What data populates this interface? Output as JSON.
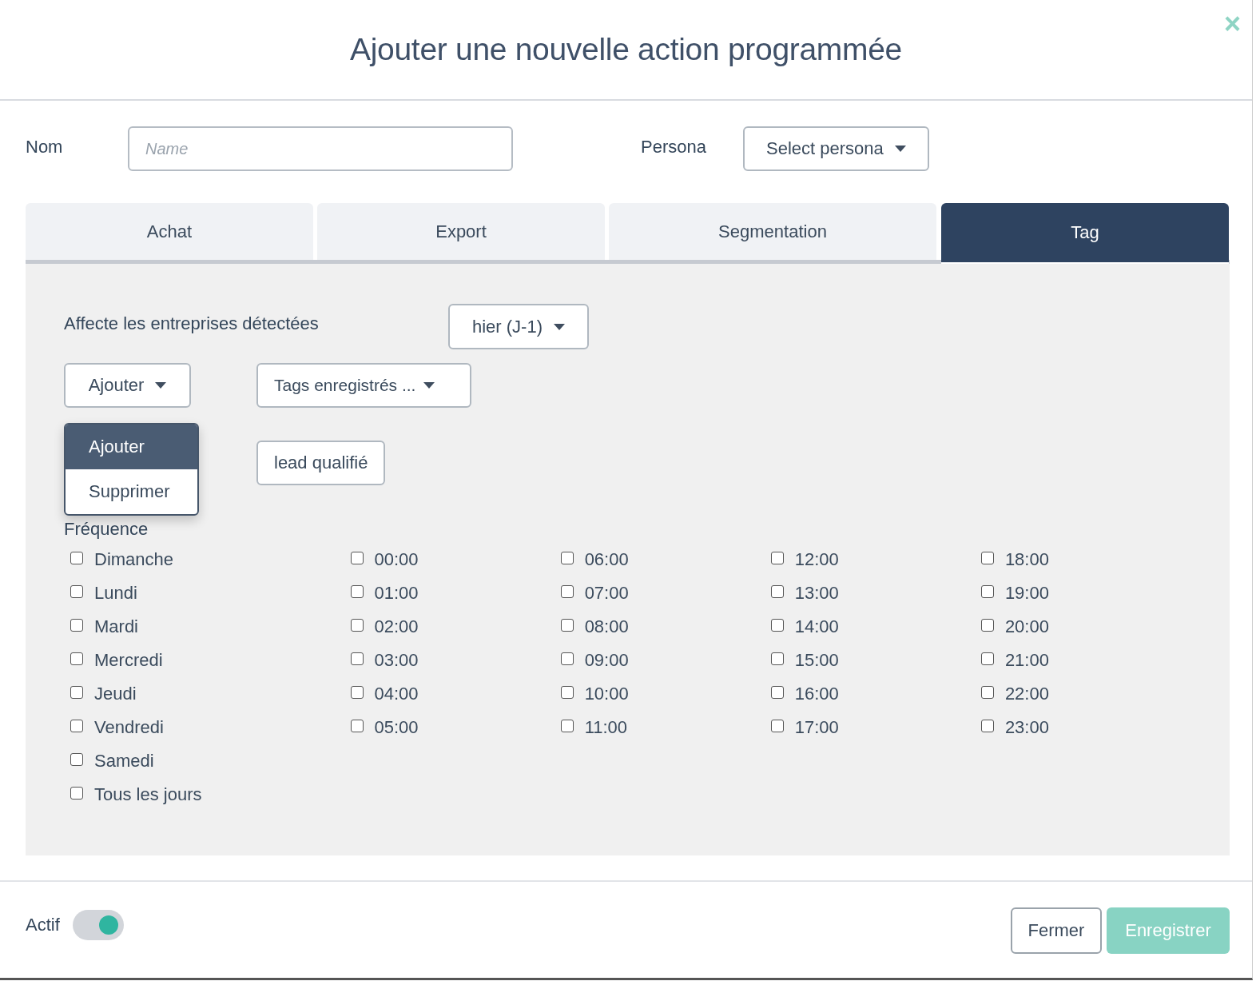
{
  "dialog": {
    "title": "Ajouter une nouvelle action programmée",
    "close": "×"
  },
  "form": {
    "name_label": "Nom",
    "name_placeholder": "Name",
    "persona_label": "Persona",
    "persona_value": "Select persona"
  },
  "tabs": [
    {
      "label": "Achat",
      "selected": false
    },
    {
      "label": "Export",
      "selected": false
    },
    {
      "label": "Segmentation",
      "selected": false
    },
    {
      "label": "Tag",
      "selected": true
    }
  ],
  "panel": {
    "affect_label": "Affecte les entreprises détectées",
    "period": "hier (J-1)",
    "action": "Ajouter",
    "tags_select": "Tags enregistrés ...",
    "tag_chips": [
      "lead qualifié"
    ],
    "action_menu": [
      {
        "label": "Ajouter",
        "selected": true
      },
      {
        "label": "Supprimer",
        "selected": false
      }
    ],
    "frequency_label": "Fréquence",
    "days": [
      {
        "label": "Dimanche",
        "checked": false
      },
      {
        "label": "Lundi",
        "checked": false
      },
      {
        "label": "Mardi",
        "checked": false
      },
      {
        "label": "Mercredi",
        "checked": false
      },
      {
        "label": "Jeudi",
        "checked": false
      },
      {
        "label": "Vendredi",
        "checked": false
      },
      {
        "label": "Samedi",
        "checked": false
      },
      {
        "label": "Tous les jours",
        "checked": false
      }
    ],
    "hours": [
      {
        "label": "00:00",
        "checked": false
      },
      {
        "label": "01:00",
        "checked": false
      },
      {
        "label": "02:00",
        "checked": false
      },
      {
        "label": "03:00",
        "checked": false
      },
      {
        "label": "04:00",
        "checked": false
      },
      {
        "label": "05:00",
        "checked": false
      },
      {
        "label": "06:00",
        "checked": false
      },
      {
        "label": "07:00",
        "checked": false
      },
      {
        "label": "08:00",
        "checked": false
      },
      {
        "label": "09:00",
        "checked": false
      },
      {
        "label": "10:00",
        "checked": false
      },
      {
        "label": "11:00",
        "checked": false
      },
      {
        "label": "12:00",
        "checked": false
      },
      {
        "label": "13:00",
        "checked": false
      },
      {
        "label": "14:00",
        "checked": false
      },
      {
        "label": "15:00",
        "checked": false
      },
      {
        "label": "16:00",
        "checked": false
      },
      {
        "label": "17:00",
        "checked": false
      },
      {
        "label": "18:00",
        "checked": false
      },
      {
        "label": "19:00",
        "checked": false
      },
      {
        "label": "20:00",
        "checked": false
      },
      {
        "label": "21:00",
        "checked": false
      },
      {
        "label": "22:00",
        "checked": false
      },
      {
        "label": "23:00",
        "checked": false
      }
    ]
  },
  "footer": {
    "active_label": "Actif",
    "active_on": true,
    "buttons": [
      {
        "label": "Fermer",
        "kind": "secondary",
        "disabled": false
      },
      {
        "label": "Enregistrer",
        "kind": "primary",
        "disabled": true
      }
    ]
  }
}
